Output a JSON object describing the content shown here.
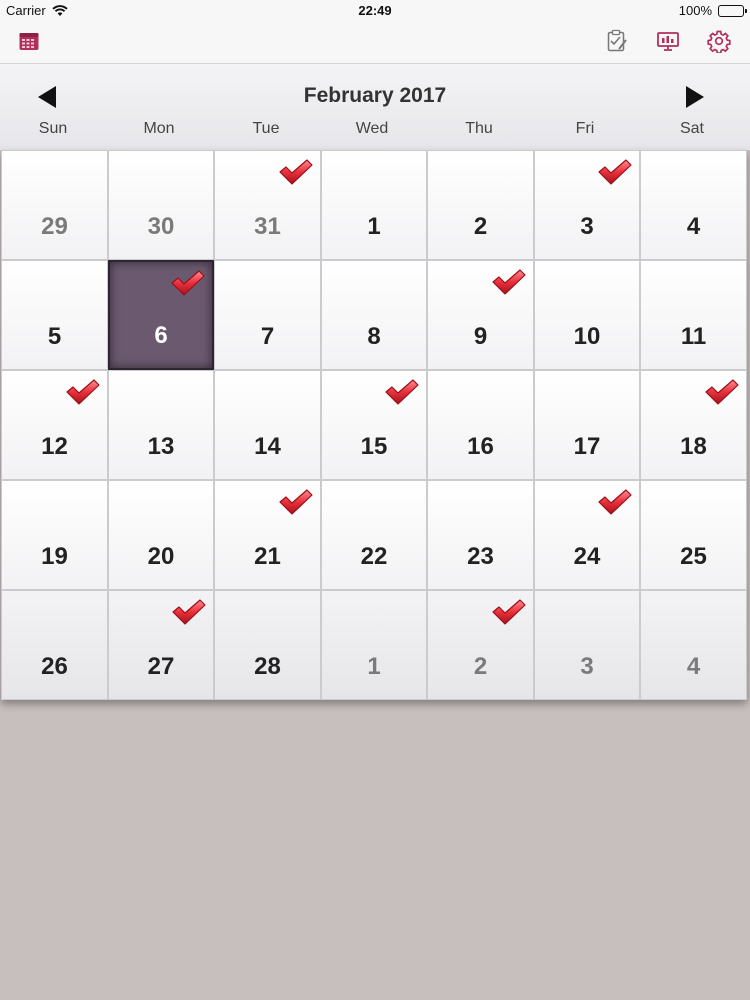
{
  "status_bar": {
    "carrier": "Carrier",
    "time": "22:49",
    "battery": "100%"
  },
  "toolbar": {
    "icons": [
      "calendar-icon",
      "clipboard-check-icon",
      "presentation-icon",
      "gear-icon"
    ]
  },
  "calendar": {
    "title": "February 2017",
    "weekdays": [
      "Sun",
      "Mon",
      "Tue",
      "Wed",
      "Thu",
      "Fri",
      "Sat"
    ],
    "accent_color": "#6b5a6f",
    "check_color": "#e8303a",
    "weeks": [
      [
        {
          "day": "29",
          "other": true,
          "check": false
        },
        {
          "day": "30",
          "other": true,
          "check": false
        },
        {
          "day": "31",
          "other": true,
          "check": true
        },
        {
          "day": "1",
          "other": false,
          "check": false
        },
        {
          "day": "2",
          "other": false,
          "check": false
        },
        {
          "day": "3",
          "other": false,
          "check": true
        },
        {
          "day": "4",
          "other": false,
          "check": false
        }
      ],
      [
        {
          "day": "5",
          "other": false,
          "check": false
        },
        {
          "day": "6",
          "other": false,
          "check": true,
          "selected": true
        },
        {
          "day": "7",
          "other": false,
          "check": false
        },
        {
          "day": "8",
          "other": false,
          "check": false
        },
        {
          "day": "9",
          "other": false,
          "check": true
        },
        {
          "day": "10",
          "other": false,
          "check": false
        },
        {
          "day": "11",
          "other": false,
          "check": false
        }
      ],
      [
        {
          "day": "12",
          "other": false,
          "check": true
        },
        {
          "day": "13",
          "other": false,
          "check": false
        },
        {
          "day": "14",
          "other": false,
          "check": false
        },
        {
          "day": "15",
          "other": false,
          "check": true
        },
        {
          "day": "16",
          "other": false,
          "check": false
        },
        {
          "day": "17",
          "other": false,
          "check": false
        },
        {
          "day": "18",
          "other": false,
          "check": true
        }
      ],
      [
        {
          "day": "19",
          "other": false,
          "check": false
        },
        {
          "day": "20",
          "other": false,
          "check": false
        },
        {
          "day": "21",
          "other": false,
          "check": true
        },
        {
          "day": "22",
          "other": false,
          "check": false
        },
        {
          "day": "23",
          "other": false,
          "check": false
        },
        {
          "day": "24",
          "other": false,
          "check": true
        },
        {
          "day": "25",
          "other": false,
          "check": false
        }
      ],
      [
        {
          "day": "26",
          "other": false,
          "check": false
        },
        {
          "day": "27",
          "other": false,
          "check": true
        },
        {
          "day": "28",
          "other": false,
          "check": false
        },
        {
          "day": "1",
          "other": true,
          "check": false
        },
        {
          "day": "2",
          "other": true,
          "check": true
        },
        {
          "day": "3",
          "other": true,
          "check": false
        },
        {
          "day": "4",
          "other": true,
          "check": false
        }
      ]
    ]
  }
}
